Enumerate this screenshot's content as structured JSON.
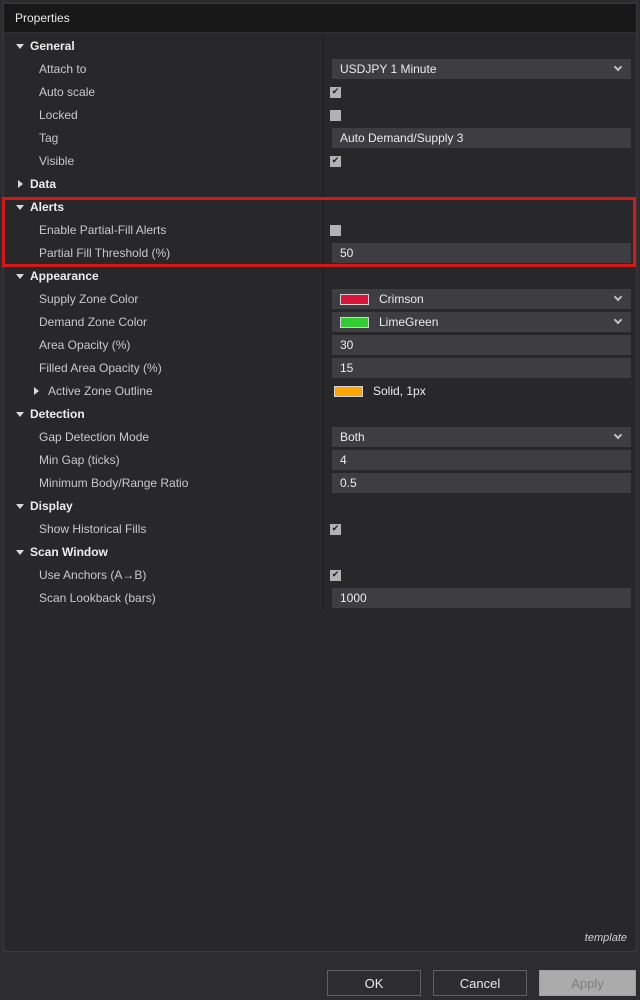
{
  "window": {
    "title": "Properties"
  },
  "colors": {
    "annotation_red": "#d41717",
    "crimson": "#DC143C",
    "limegreen": "#32CD32",
    "orange": "#FFA500"
  },
  "rows": [
    {
      "type": "section",
      "label": "General",
      "expanded": true
    },
    {
      "type": "prop",
      "label": "Attach to",
      "editor": "dropdown",
      "value": "USDJPY 1 Minute"
    },
    {
      "type": "prop",
      "label": "Auto scale",
      "editor": "checkbox",
      "checked": true
    },
    {
      "type": "prop",
      "label": "Locked",
      "editor": "checkbox",
      "checked": false
    },
    {
      "type": "prop",
      "label": "Tag",
      "editor": "text",
      "value": "Auto Demand/Supply 3"
    },
    {
      "type": "prop",
      "label": "Visible",
      "editor": "checkbox",
      "checked": true
    },
    {
      "type": "section",
      "label": "Data",
      "expanded": false
    },
    {
      "type": "section",
      "label": "Alerts",
      "expanded": true
    },
    {
      "type": "prop",
      "label": "Enable Partial-Fill Alerts",
      "editor": "checkbox",
      "checked": false
    },
    {
      "type": "prop",
      "label": "Partial Fill Threshold (%)",
      "editor": "text",
      "value": "50"
    },
    {
      "type": "section",
      "label": "Appearance",
      "expanded": true
    },
    {
      "type": "prop",
      "label": "Supply Zone Color",
      "editor": "color-dropdown",
      "value": "Crimson",
      "swatch": "#DC143C"
    },
    {
      "type": "prop",
      "label": "Demand Zone Color",
      "editor": "color-dropdown",
      "value": "LimeGreen",
      "swatch": "#32CD32"
    },
    {
      "type": "prop",
      "label": "Area Opacity (%)",
      "editor": "text",
      "value": "30"
    },
    {
      "type": "prop",
      "label": "Filled Area Opacity (%)",
      "editor": "text",
      "value": "15"
    },
    {
      "type": "subsection",
      "label": "Active Zone Outline",
      "expanded": false,
      "editor": "color-label",
      "value": "Solid, 1px",
      "swatch": "#FFA500"
    },
    {
      "type": "section",
      "label": "Detection",
      "expanded": true
    },
    {
      "type": "prop",
      "label": "Gap Detection Mode",
      "editor": "dropdown",
      "value": "Both"
    },
    {
      "type": "prop",
      "label": "Min Gap (ticks)",
      "editor": "text",
      "value": "4"
    },
    {
      "type": "prop",
      "label": "Minimum Body/Range Ratio",
      "editor": "text",
      "value": "0.5"
    },
    {
      "type": "section",
      "label": "Display",
      "expanded": true
    },
    {
      "type": "prop",
      "label": "Show Historical Fills",
      "editor": "checkbox",
      "checked": true
    },
    {
      "type": "section",
      "label": "Scan Window",
      "expanded": true
    },
    {
      "type": "prop",
      "label": "Use Anchors (A→B)",
      "editor": "checkbox",
      "checked": true
    },
    {
      "type": "prop",
      "label": "Scan Lookback (bars)",
      "editor": "text",
      "value": "1000"
    }
  ],
  "footer": {
    "template_label": "template",
    "ok": "OK",
    "cancel": "Cancel",
    "apply": "Apply"
  }
}
